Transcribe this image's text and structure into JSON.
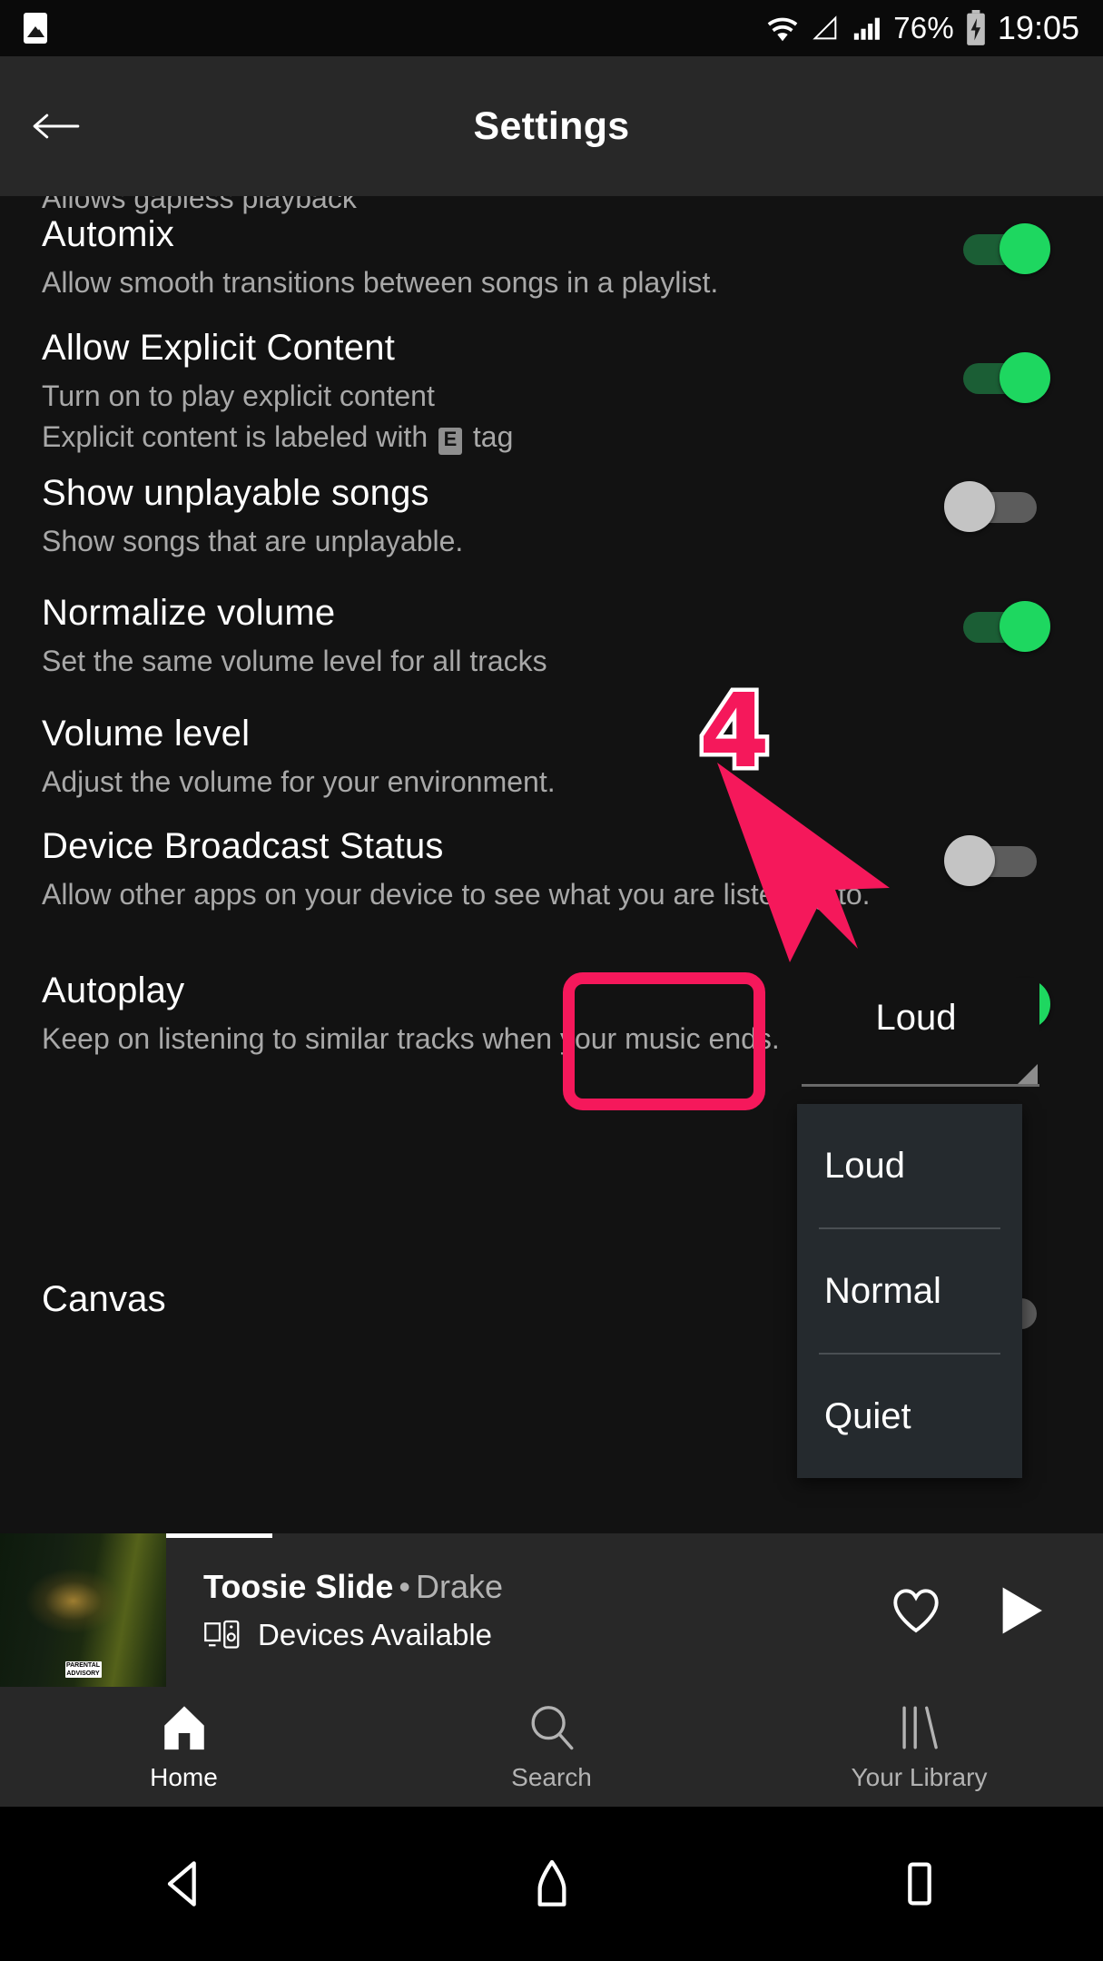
{
  "status_bar": {
    "left_icon": "gallery-icon",
    "wifi_icon": "wifi-icon",
    "signal_empty_icon": "signal-empty-icon",
    "signal_icon": "signal-bars-icon",
    "battery_text": "76%",
    "battery_icon": "battery-charging-icon",
    "clock": "19:05"
  },
  "app_bar": {
    "back_icon": "back-arrow-icon",
    "title": "Settings"
  },
  "settings": {
    "clipped_top_subtitle": "Allows gapless playback",
    "items": [
      {
        "title": "Automix",
        "subtitle": "Allow smooth transitions between songs in a playlist.",
        "control": "toggle",
        "state": "on"
      },
      {
        "title": "Allow Explicit Content",
        "subtitle_line1": "Turn on to play explicit content",
        "subtitle_line2_before": "Explicit content is labeled with ",
        "subtitle_badge": "E",
        "subtitle_line2_after": " tag",
        "control": "toggle",
        "state": "on"
      },
      {
        "title": "Show unplayable songs",
        "subtitle": "Show songs that are unplayable.",
        "control": "toggle",
        "state": "off"
      },
      {
        "title": "Normalize volume",
        "subtitle": "Set the same volume level for all tracks",
        "control": "toggle",
        "state": "on"
      },
      {
        "title": "Volume level",
        "subtitle": "Adjust the volume for your environment.",
        "control": "spinner",
        "selected": "Loud",
        "options": [
          "Loud",
          "Normal",
          "Quiet"
        ]
      },
      {
        "title": "Device Broadcast Status",
        "subtitle": "Allow other apps on your device to see what you are listening to.",
        "control": "toggle",
        "state": "off"
      },
      {
        "title": "Autoplay",
        "subtitle": "Keep on listening to similar tracks when your music ends.",
        "control": "toggle",
        "state": "on"
      },
      {
        "title": "Canvas",
        "subtitle": "",
        "control": "toggle",
        "state": "off"
      }
    ]
  },
  "annotation": {
    "number": "4",
    "color": "#f5185b",
    "outline_color": "#ffffff"
  },
  "now_playing": {
    "track": "Toosie Slide",
    "separator": "•",
    "artist": "Drake",
    "devices_icon": "devices-icon",
    "devices_text": "Devices Available",
    "like_icon": "heart-icon",
    "play_icon": "play-icon",
    "album_art_label": "PARENTAL ADVISORY EXPLICIT CONTENT"
  },
  "tab_bar": {
    "tabs": [
      {
        "label": "Home",
        "icon": "home-icon",
        "active": true
      },
      {
        "label": "Search",
        "icon": "search-icon",
        "active": false
      },
      {
        "label": "Your Library",
        "icon": "library-icon",
        "active": false
      }
    ]
  },
  "nav_bar": {
    "back_icon": "android-back-icon",
    "home_icon": "android-home-icon",
    "recents_icon": "android-recents-icon"
  },
  "colors": {
    "accent_green": "#1ed760",
    "annotation_pink": "#f5185b",
    "background": "#121212",
    "surface": "#282828"
  }
}
